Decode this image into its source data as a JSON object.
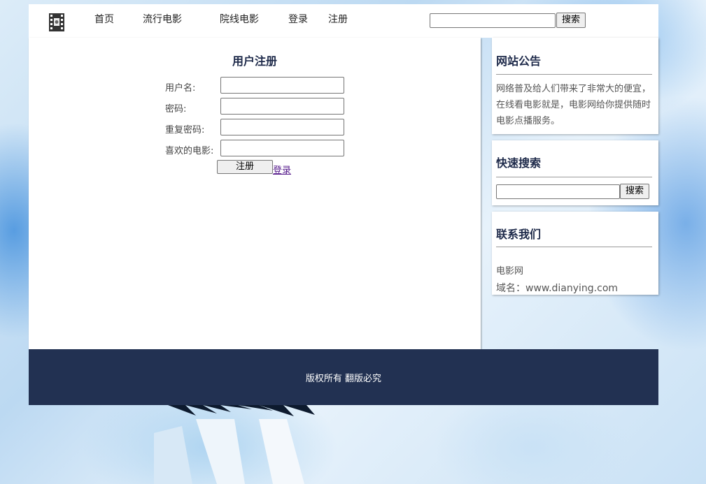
{
  "header": {
    "logo_icon": "film-icon",
    "nav": {
      "home": "首页",
      "popular": "流行电影",
      "cinema": "院线电影",
      "login": "登录",
      "register": "注册"
    },
    "search": {
      "value": "",
      "button": "搜索"
    }
  },
  "register_form": {
    "title": "用户注册",
    "fields": [
      {
        "label": "用户名:",
        "value": ""
      },
      {
        "label": "密码:",
        "value": ""
      },
      {
        "label": "重复密码:",
        "value": ""
      },
      {
        "label": "喜欢的电影:",
        "value": ""
      }
    ],
    "submit": "注册",
    "login_link": "登录"
  },
  "sidebar": {
    "notice": {
      "title": "网站公告",
      "text": "网络普及给人们带来了非常大的便宜，在线看电影就是，电影网给你提供随时电影点播服务。"
    },
    "quick_search": {
      "title": "快速搜索",
      "value": "",
      "button": "搜索"
    },
    "contact": {
      "title": "联系我们",
      "name": "电影网",
      "domain": "域名：www.dianying.com"
    }
  },
  "footer": {
    "text": "版权所有 翻版必究"
  },
  "colors": {
    "accent_dark_navy": "#223152",
    "title_text": "#1e2a4a",
    "visited_link": "#551a8b"
  }
}
